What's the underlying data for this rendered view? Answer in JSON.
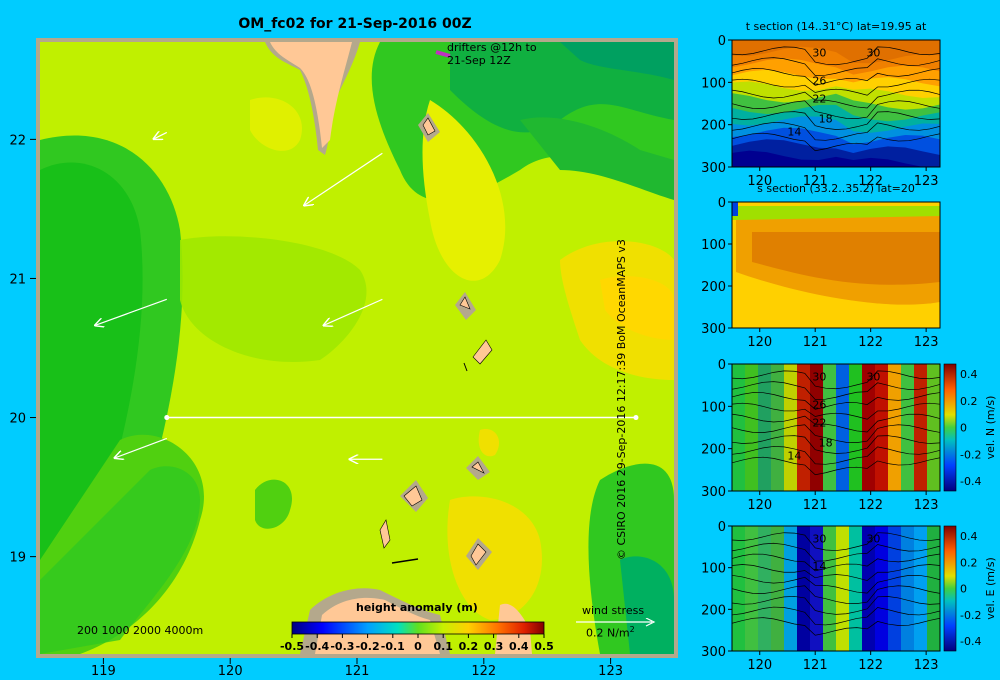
{
  "title": "OM_fc02 for 21-Sep-2016 00Z",
  "credit": "© CSIRO 2016   29-Sep-2016 12:17:39 BoM OceanMAPS v3",
  "main_map": {
    "drifters_label": [
      "drifters @12h to",
      "21-Sep 12Z"
    ],
    "depth_legend": "200  1000  2000  4000m",
    "colorbar_title": "height anomaly  (m)",
    "colorbar_ticks": [
      "-0.5",
      "-0.4",
      "-0.3",
      "-0.2",
      "-0.1",
      "0",
      "0.1",
      "0.2",
      "0.3",
      "0.4",
      "0.5"
    ],
    "wind_label": "wind stress",
    "wind_scale": "0.2 N/m",
    "wind_scale_sup": "2",
    "land_color": "#ffc896",
    "shelf_color": "#b4a88c"
  },
  "chart_data": [
    {
      "type": "heatmap",
      "title": "OM_fc02 for 21-Sep-2016 00Z",
      "quantity": "height anomaly (m)",
      "x_ticks": [
        "119",
        "120",
        "121",
        "122",
        "123"
      ],
      "y_ticks": [
        "19",
        "20",
        "21",
        "22"
      ],
      "xlim": [
        118.5,
        123.5
      ],
      "ylim": [
        18.3,
        22.7
      ],
      "clim": [
        -0.5,
        0.5
      ],
      "section_line": {
        "lat": 20,
        "lon_from": 119.5,
        "lon_to": 123.2
      },
      "wind_arrows": [
        {
          "lon": 119.5,
          "lat": 22.05,
          "u": -0.1,
          "v": -0.05
        },
        {
          "lon": 121.2,
          "lat": 21.9,
          "u": -0.6,
          "v": -0.4
        },
        {
          "lon": 119.5,
          "lat": 20.85,
          "u": -0.55,
          "v": -0.2
        },
        {
          "lon": 121.2,
          "lat": 20.85,
          "u": -0.45,
          "v": -0.2
        },
        {
          "lon": 119.5,
          "lat": 19.85,
          "u": -0.4,
          "v": -0.15
        },
        {
          "lon": 121.2,
          "lat": 19.7,
          "u": -0.25,
          "v": 0.0
        }
      ]
    },
    {
      "type": "heatmap",
      "title": "t section (14..31°C) lat=19.95 at",
      "x_ticks": [
        "120",
        "121",
        "122",
        "123"
      ],
      "y_ticks": [
        "0",
        "100",
        "200",
        "300"
      ],
      "xlim": [
        119.5,
        123.25
      ],
      "ylim": [
        300,
        0
      ],
      "contour_labels": [
        "30",
        "30",
        "26",
        "22",
        "18",
        "14"
      ]
    },
    {
      "type": "heatmap",
      "title": "s section (33.2..35.2) lat=20",
      "x_ticks": [
        "120",
        "121",
        "122",
        "123"
      ],
      "y_ticks": [
        "0",
        "100",
        "200",
        "300"
      ],
      "xlim": [
        119.5,
        123.25
      ],
      "ylim": [
        300,
        0
      ]
    },
    {
      "type": "heatmap",
      "title": "",
      "colorbar_label": "vel. N  (m/s)",
      "colorbar_ticks": [
        "0.4",
        "0.2",
        "0",
        "-0.2",
        "-0.4"
      ],
      "x_ticks": [
        "120",
        "121",
        "122",
        "123"
      ],
      "y_ticks": [
        "0",
        "100",
        "200",
        "300"
      ],
      "xlim": [
        119.5,
        123.25
      ],
      "ylim": [
        300,
        0
      ],
      "contour_labels": [
        "30",
        "30",
        "26",
        "22",
        "18",
        "14"
      ]
    },
    {
      "type": "heatmap",
      "title": "",
      "colorbar_label": "vel. E  (m/s)",
      "colorbar_ticks": [
        "0.4",
        "0.2",
        "0",
        "-0.2",
        "-0.4"
      ],
      "x_ticks": [
        "120",
        "121",
        "122",
        "123"
      ],
      "y_ticks": [
        "0",
        "100",
        "200",
        "300"
      ],
      "xlim": [
        119.5,
        123.25
      ],
      "ylim": [
        300,
        0
      ],
      "contour_labels": [
        "30",
        "30",
        "14"
      ]
    }
  ]
}
